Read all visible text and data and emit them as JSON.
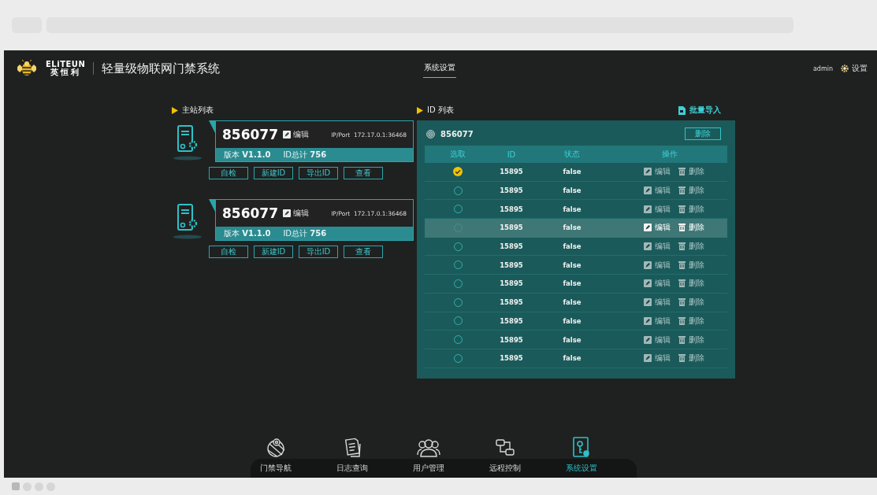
{
  "header": {
    "brand": "ELiTEUN",
    "brand_cn": "英恒利",
    "title": "轻量级物联网门禁系统",
    "tab": {
      "label": "系统设置",
      "selected": true
    },
    "user": "admin",
    "settings": "设置"
  },
  "stations": {
    "heading": "主站列表",
    "cards": [
      {
        "code": "856077",
        "edit": "编辑",
        "ip_label": "IP/Port",
        "ip": "172.17.0.1:36468",
        "version_label": "版本",
        "version": "V1.1.0",
        "count_label": "ID总计",
        "count": "756",
        "buttons": [
          "自检",
          "新建ID",
          "导出ID",
          "查看"
        ]
      },
      {
        "code": "856077",
        "edit": "编辑",
        "ip_label": "IP/Port",
        "ip": "172.17.0.1:36468",
        "version_label": "版本",
        "version": "V1.1.0",
        "count_label": "ID总计",
        "count": "756",
        "buttons": [
          "自检",
          "新建ID",
          "导出ID",
          "查看"
        ]
      }
    ]
  },
  "id_list": {
    "heading": "ID 列表",
    "import": "批量导入",
    "station": "856077",
    "delete": "删除",
    "columns": [
      "选取",
      "ID",
      "状态",
      "操作"
    ],
    "rows": [
      {
        "checked": true,
        "highlighted": false,
        "id": "15895",
        "status": "false",
        "edit": "编辑",
        "delete": "删除"
      },
      {
        "checked": false,
        "highlighted": false,
        "id": "15895",
        "status": "false",
        "edit": "编辑",
        "delete": "删除"
      },
      {
        "checked": false,
        "highlighted": false,
        "id": "15895",
        "status": "false",
        "edit": "编辑",
        "delete": "删除"
      },
      {
        "checked": false,
        "highlighted": true,
        "id": "15895",
        "status": "false",
        "edit": "编辑",
        "delete": "删除"
      },
      {
        "checked": false,
        "highlighted": false,
        "id": "15895",
        "status": "false",
        "edit": "编辑",
        "delete": "删除"
      },
      {
        "checked": false,
        "highlighted": false,
        "id": "15895",
        "status": "false",
        "edit": "编辑",
        "delete": "删除"
      },
      {
        "checked": false,
        "highlighted": false,
        "id": "15895",
        "status": "false",
        "edit": "编辑",
        "delete": "删除"
      },
      {
        "checked": false,
        "highlighted": false,
        "id": "15895",
        "status": "false",
        "edit": "编辑",
        "delete": "删除"
      },
      {
        "checked": false,
        "highlighted": false,
        "id": "15895",
        "status": "false",
        "edit": "编辑",
        "delete": "删除"
      },
      {
        "checked": false,
        "highlighted": false,
        "id": "15895",
        "status": "false",
        "edit": "编辑",
        "delete": "删除"
      },
      {
        "checked": false,
        "highlighted": false,
        "id": "15895",
        "status": "false",
        "edit": "编辑",
        "delete": "删除"
      }
    ]
  },
  "nav": [
    {
      "kind": "map",
      "label": "门禁导航",
      "selected": false
    },
    {
      "kind": "log",
      "label": "日志查询",
      "selected": false
    },
    {
      "kind": "users",
      "label": "用户管理",
      "selected": false
    },
    {
      "kind": "remote",
      "label": "远程控制",
      "selected": false
    },
    {
      "kind": "settings",
      "label": "系统设置",
      "selected": true
    }
  ]
}
